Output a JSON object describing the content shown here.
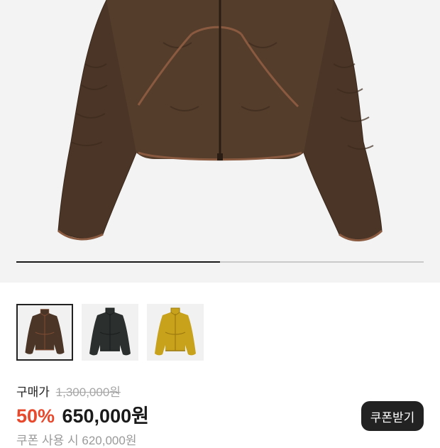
{
  "gallery": {
    "progress_fraction": 0.5,
    "thumbnails": [
      {
        "color_name": "brown",
        "body_color": "#4a3526",
        "trim_color": "#7a4a33",
        "selected": true
      },
      {
        "color_name": "black",
        "body_color": "#2b302e",
        "trim_color": "#1b1e1d",
        "selected": false
      },
      {
        "color_name": "mustard",
        "body_color": "#c9a21c",
        "trim_color": "#9c7a0e",
        "selected": false
      }
    ]
  },
  "price": {
    "buy_label": "구매가",
    "original_price": "1,300,000원",
    "discount_rate": "50%",
    "sale_price": "650,000원",
    "coupon_price_text": "쿠폰 사용 시 620,000원"
  },
  "coupon_button": {
    "label": "쿠폰받기"
  },
  "colors": {
    "accent_red": "#e8492c",
    "button_bg": "#222222",
    "hero_bg": "#f3f3f3"
  },
  "icons": {
    "hero_image": "brown-jacket-image",
    "thumbnail_image": "jacket-thumbnail-image"
  }
}
